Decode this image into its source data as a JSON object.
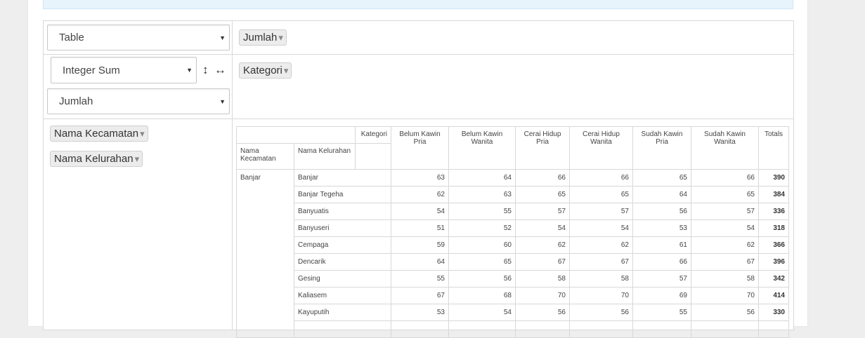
{
  "controls": {
    "renderer": "Table",
    "aggregator": "Integer Sum",
    "value_field": "Jumlah",
    "swap_rows_icon": "↕",
    "swap_cols_icon": "↔"
  },
  "unused_fields": [
    "Jumlah"
  ],
  "col_fields": [
    "Kategori"
  ],
  "row_fields": [
    "Nama Kecamatan",
    "Nama Kelurahan"
  ],
  "table": {
    "col_axis_label": "Kategori",
    "row_axis_labels": [
      "Nama Kecamatan",
      "Nama Kelurahan"
    ],
    "columns": [
      "Belum Kawin Pria",
      "Belum Kawin Wanita",
      "Cerai Hidup Pria",
      "Cerai Hidup Wanita",
      "Sudah Kawin Pria",
      "Sudah Kawin Wanita",
      "Totals"
    ],
    "group": "Banjar",
    "rows": [
      {
        "name": "Banjar",
        "values": [
          "63",
          "64",
          "66",
          "66",
          "65",
          "66"
        ],
        "total": "390"
      },
      {
        "name": "Banjar Tegeha",
        "values": [
          "62",
          "63",
          "65",
          "65",
          "64",
          "65"
        ],
        "total": "384"
      },
      {
        "name": "Banyuatis",
        "values": [
          "54",
          "55",
          "57",
          "57",
          "56",
          "57"
        ],
        "total": "336"
      },
      {
        "name": "Banyuseri",
        "values": [
          "51",
          "52",
          "54",
          "54",
          "53",
          "54"
        ],
        "total": "318"
      },
      {
        "name": "Cempaga",
        "values": [
          "59",
          "60",
          "62",
          "62",
          "61",
          "62"
        ],
        "total": "366"
      },
      {
        "name": "Dencarik",
        "values": [
          "64",
          "65",
          "67",
          "67",
          "66",
          "67"
        ],
        "total": "396"
      },
      {
        "name": "Gesing",
        "values": [
          "55",
          "56",
          "58",
          "58",
          "57",
          "58"
        ],
        "total": "342"
      },
      {
        "name": "Kaliasem",
        "values": [
          "67",
          "68",
          "70",
          "70",
          "69",
          "70"
        ],
        "total": "414"
      },
      {
        "name": "Kayuputih",
        "values": [
          "53",
          "54",
          "56",
          "56",
          "55",
          "56"
        ],
        "total": "330"
      },
      {
        "name": "",
        "values": [
          "",
          "",
          "",
          "",
          "",
          ""
        ],
        "total": ""
      }
    ]
  }
}
